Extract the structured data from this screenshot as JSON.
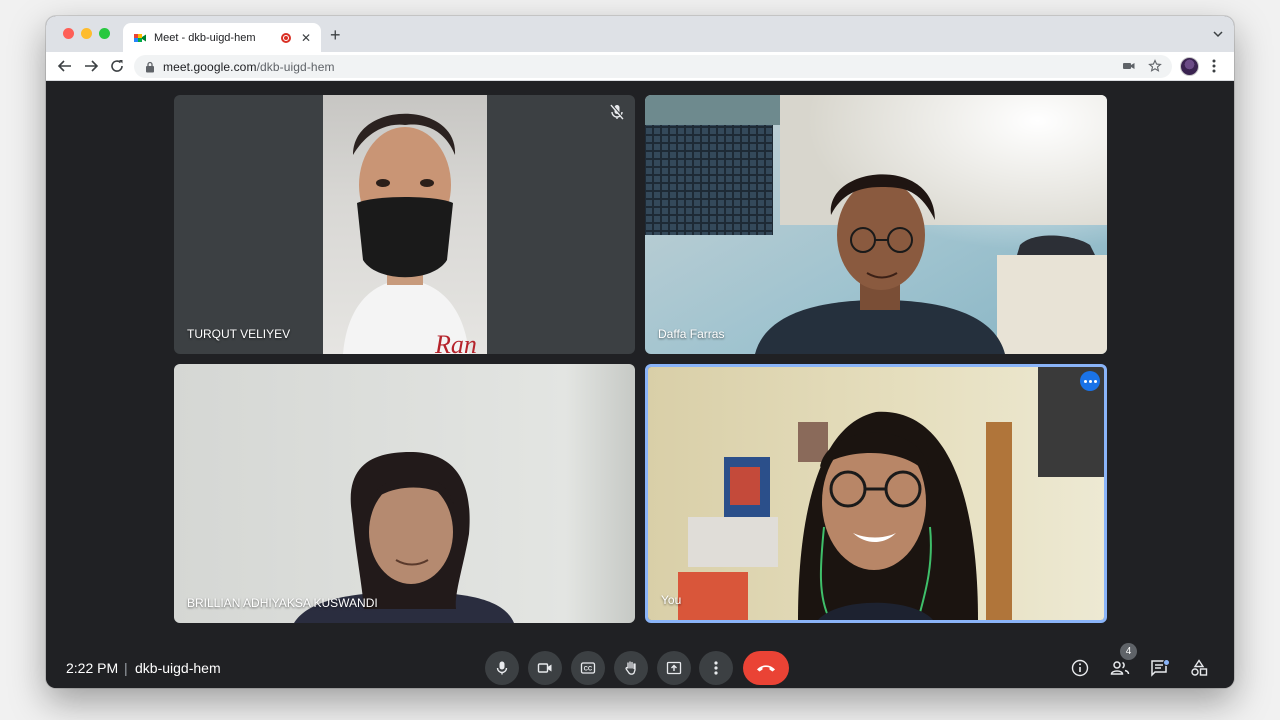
{
  "browser": {
    "tab_title": "Meet - dkb-uigd-hem",
    "url_host": "meet.google.com",
    "url_path": "/dkb-uigd-hem"
  },
  "participants": [
    {
      "name": "TURQUT VELIYEV",
      "muted": true
    },
    {
      "name": "Daffa Farras",
      "muted": false
    },
    {
      "name": "BRILLIAN ADHIYAKSA KUSWANDI",
      "muted": false
    },
    {
      "name": "You",
      "muted": false,
      "active_speaker": true
    }
  ],
  "bottom_bar": {
    "time": "2:22 PM",
    "separator": "|",
    "meeting_code": "dkb-uigd-hem",
    "participant_count": "4"
  },
  "colors": {
    "meet_bg": "#202124",
    "control_bg": "#3c4043",
    "end_call": "#ea4335",
    "accent_blue": "#8ab4f8",
    "more_button": "#1a73e8"
  },
  "icons": {
    "controls": [
      "microphone-icon",
      "camera-icon",
      "captions-icon",
      "raise-hand-icon",
      "present-icon",
      "more-options-icon",
      "end-call-icon"
    ],
    "right": [
      "info-icon",
      "people-icon",
      "chat-icon",
      "activities-icon"
    ]
  }
}
